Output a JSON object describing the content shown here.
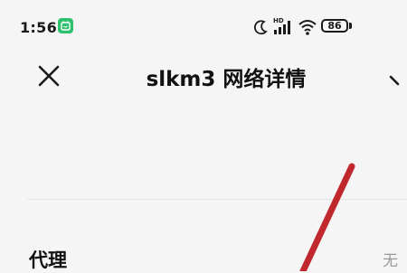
{
  "status_bar": {
    "time": "1:56",
    "battery_level": "86",
    "hd_label": "HD"
  },
  "header": {
    "title": "slkm3 网络详情"
  },
  "settings": {
    "proxy_label": "代理",
    "proxy_value": "无"
  },
  "colors": {
    "background": "#f5f5f5",
    "app_badge": "#2ec16d",
    "annotation": "#c0282d",
    "secondary_text": "#9a9a9a"
  }
}
